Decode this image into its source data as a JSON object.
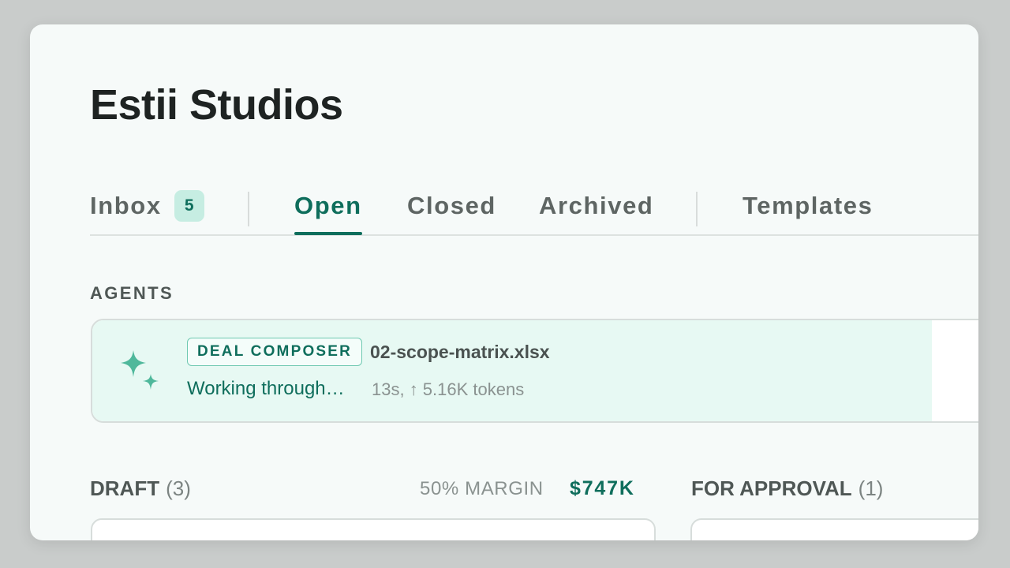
{
  "app": {
    "title": "Estii Studios"
  },
  "tabs": [
    {
      "label": "Inbox",
      "badge": "5",
      "active": false
    },
    {
      "label": "Open",
      "active": true
    },
    {
      "label": "Closed",
      "active": false
    },
    {
      "label": "Archived",
      "active": false
    },
    {
      "label": "Templates",
      "active": false
    }
  ],
  "agents": {
    "section_label": "AGENTS",
    "card": {
      "icon": "sparkle-icon",
      "tag": "DEAL COMPOSER",
      "file": "02-scope-matrix.xlsx",
      "status": "Working through…",
      "meta": "13s, ↑ 5.16K tokens"
    }
  },
  "columns": {
    "draft": {
      "label": "DRAFT",
      "count": "(3)",
      "margin_label": "50% MARGIN",
      "margin_value": "$747K"
    },
    "for_approval": {
      "label": "FOR APPROVAL",
      "count": "(1)"
    }
  },
  "colors": {
    "accent": "#0f6e5c",
    "accent_light": "#c6ede2",
    "agent_bg": "#e7f9f3",
    "sparkle": "#4fb89b"
  }
}
